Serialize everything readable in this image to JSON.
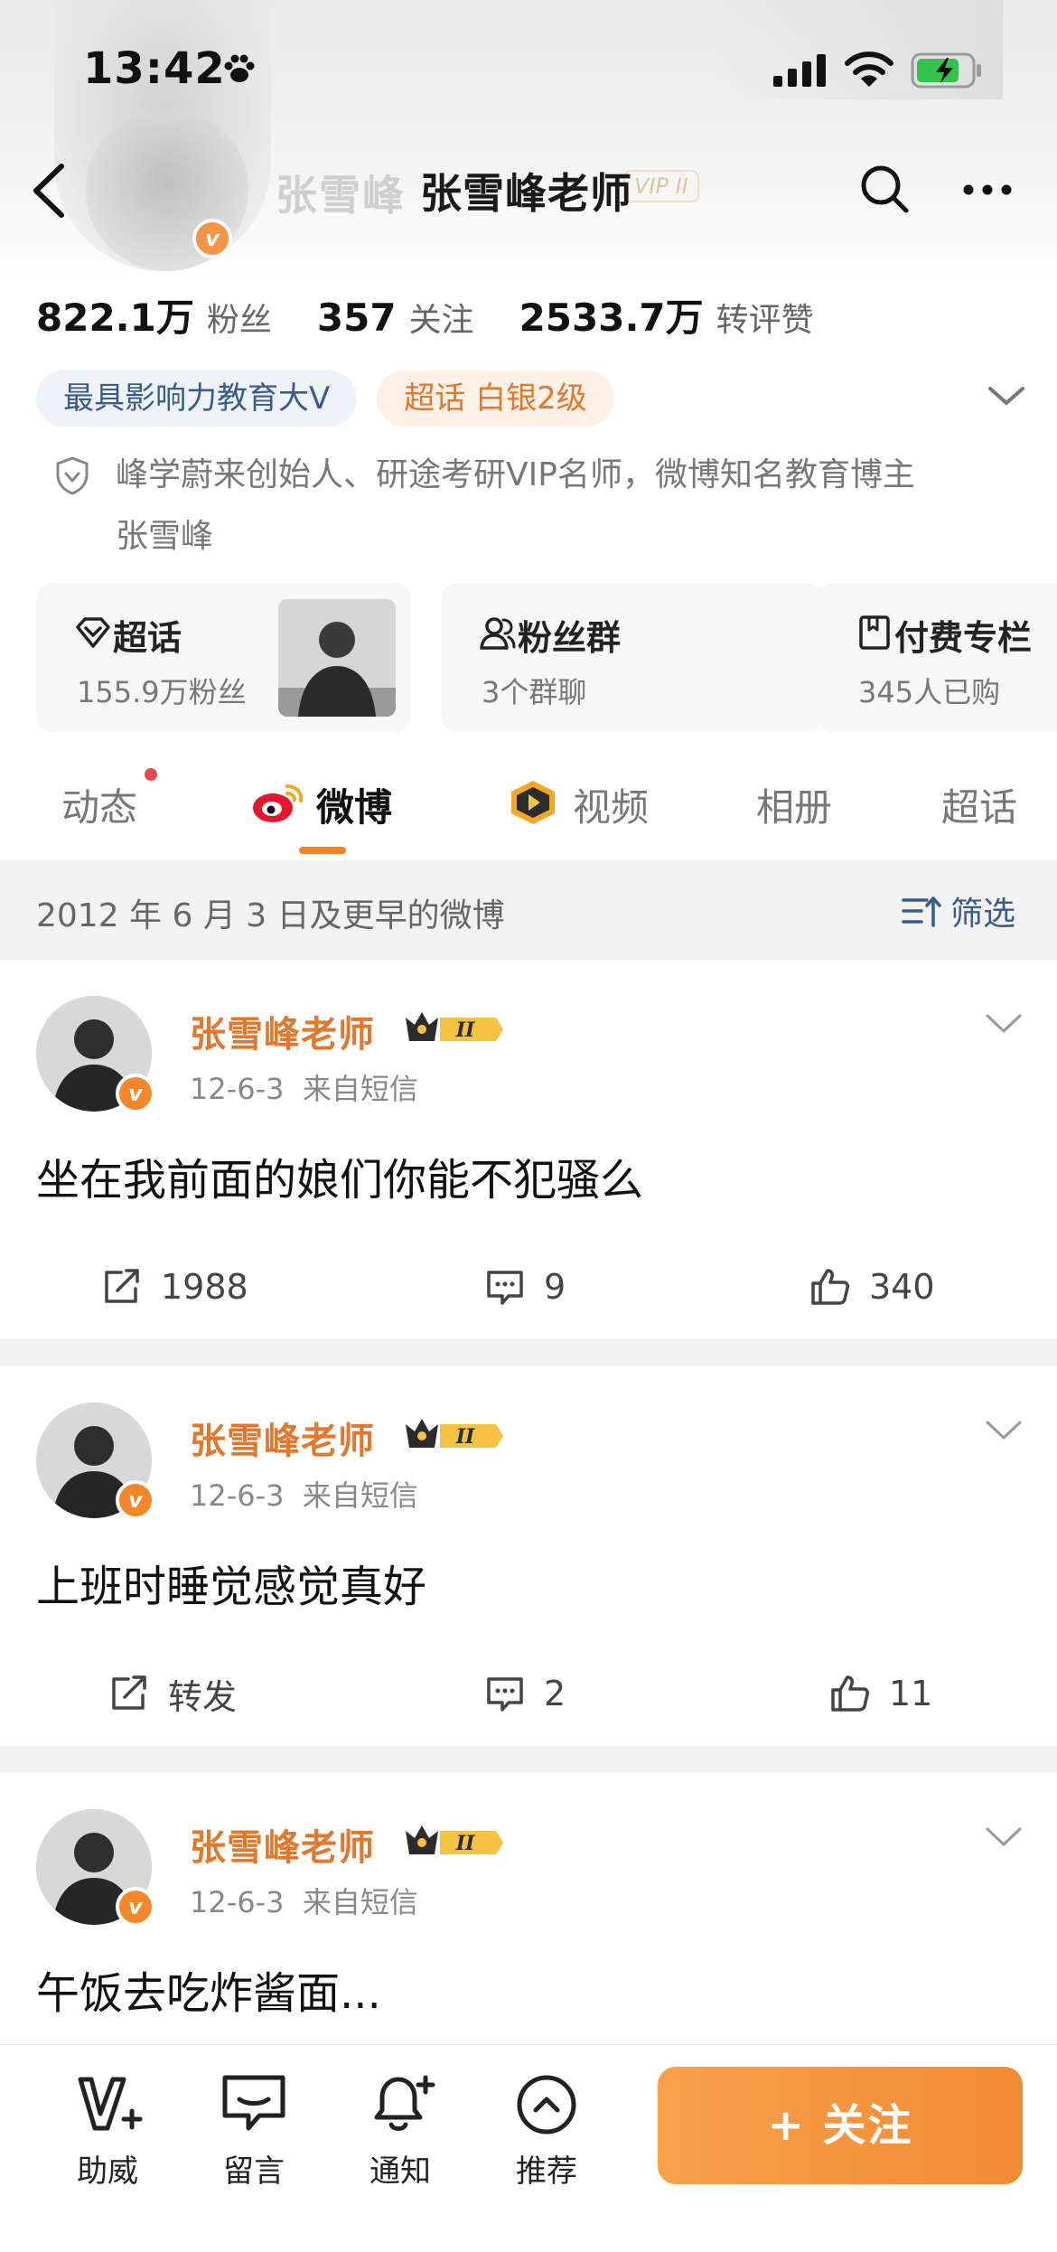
{
  "status_bar": {
    "time": "13:42"
  },
  "nav": {
    "title": "张雪峰老师",
    "ghost_name": "张雪峰",
    "ghost_vip": "VIP II"
  },
  "stats": [
    {
      "value": "822.1万",
      "label": "粉丝"
    },
    {
      "value": "357",
      "label": "关注"
    },
    {
      "value": "2533.7万",
      "label": "转评赞"
    }
  ],
  "badges": [
    {
      "label": "最具影响力教育大V",
      "style": "blue"
    },
    {
      "label": "超话 白银2级",
      "style": "orange"
    }
  ],
  "verification": {
    "line1": "峰学蔚来创始人、研途考研VIP名师，微博知名教育博主",
    "line2": "张雪峰"
  },
  "cards": [
    {
      "title": "超话",
      "subtitle": "155.9万粉丝",
      "icon": "diamond-icon"
    },
    {
      "title": "粉丝群",
      "subtitle": "3个群聊",
      "icon": "group-icon"
    },
    {
      "title": "付费专栏",
      "subtitle": "345人已购",
      "icon": "book-icon"
    }
  ],
  "tabs": [
    {
      "label": "动态",
      "active": false,
      "dot": true
    },
    {
      "label": "微博",
      "active": true
    },
    {
      "label": "视频",
      "active": false
    },
    {
      "label": "相册",
      "active": false
    },
    {
      "label": "超话",
      "active": false
    }
  ],
  "filter": {
    "text": "2012 年 6 月 3 日及更早的微博",
    "button": "筛选"
  },
  "posts": [
    {
      "author": "张雪峰老师",
      "crown_level": "II",
      "date": "12-6-3",
      "source": "来自短信",
      "text": "坐在我前面的娘们你能不犯骚么",
      "repost": "1988",
      "comments": "9",
      "likes": "340"
    },
    {
      "author": "张雪峰老师",
      "crown_level": "II",
      "date": "12-6-3",
      "source": "来自短信",
      "text": "上班时睡觉感觉真好",
      "repost": "转发",
      "comments": "2",
      "likes": "11"
    },
    {
      "author": "张雪峰老师",
      "crown_level": "II",
      "date": "12-6-3",
      "source": "来自短信",
      "text": "午饭去吃炸酱面..."
    }
  ],
  "bottom_bar": {
    "items": [
      {
        "label": "助威",
        "icon": "cheer-icon"
      },
      {
        "label": "留言",
        "icon": "message-icon"
      },
      {
        "label": "通知",
        "icon": "bell-icon"
      },
      {
        "label": "推荐",
        "icon": "recommend-icon"
      }
    ],
    "follow": "+ 关注"
  },
  "colors": {
    "accent_orange": "#f38b34",
    "name_orange": "#e3772c",
    "link_blue": "#3a5a8c",
    "badge_blue_bg": "#eef2f9",
    "badge_orange_bg": "#fdf0e6"
  }
}
